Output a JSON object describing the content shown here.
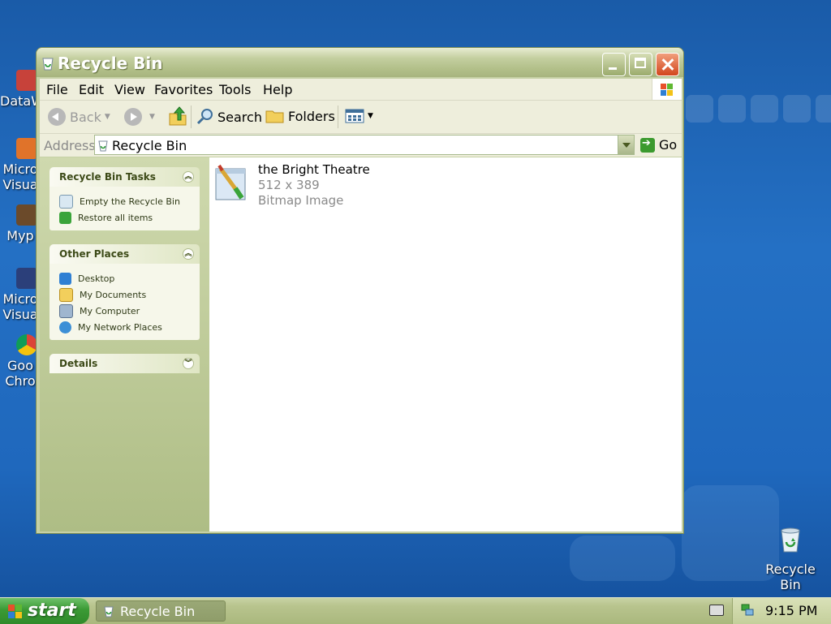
{
  "desktop": {
    "icons": [
      {
        "label": "DataW"
      },
      {
        "label": "Micro"
      },
      {
        "label": "Visua"
      },
      {
        "label": "Myp"
      },
      {
        "label": "Micro"
      },
      {
        "label": "Visua"
      },
      {
        "label": "Goo"
      },
      {
        "label": "Chro"
      }
    ],
    "recycle_bin": {
      "line1": "Recycle",
      "line2": "Bin"
    }
  },
  "window": {
    "title": "Recycle Bin",
    "menu": [
      "File",
      "Edit",
      "View",
      "Favorites",
      "Tools",
      "Help"
    ],
    "toolbar": {
      "back": "Back",
      "search": "Search",
      "folders": "Folders"
    },
    "address": {
      "label": "Address",
      "value": "Recycle Bin",
      "go": "Go"
    },
    "tasks": {
      "title": "Recycle Bin Tasks",
      "items": [
        "Empty the Recycle Bin",
        "Restore all items"
      ]
    },
    "other_places": {
      "title": "Other Places",
      "items": [
        "Desktop",
        "My Documents",
        "My Computer",
        "My Network Places"
      ]
    },
    "details": {
      "title": "Details"
    },
    "files": [
      {
        "name": "the Bright Theatre",
        "dimensions": "512 x 389",
        "type": "Bitmap Image"
      }
    ]
  },
  "taskbar": {
    "start": "start",
    "task": "Recycle Bin",
    "clock": "9:15 PM"
  },
  "colors": {
    "desktop": "#1f68bd",
    "window_chrome": "#c6d1a5",
    "start_button": "#3b9a35",
    "close_button": "#d2451c"
  }
}
